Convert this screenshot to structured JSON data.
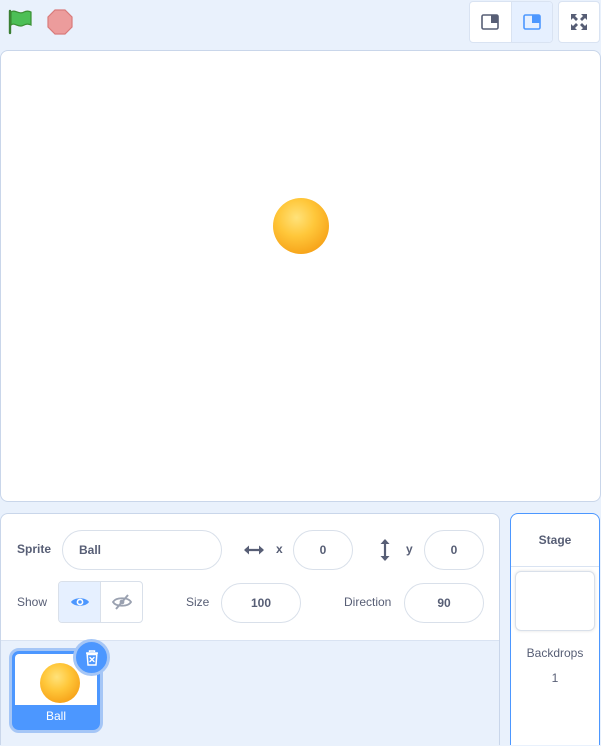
{
  "toolbar": {
    "green_flag_icon": "green-flag-icon",
    "stop_icon": "stop-icon",
    "layout_small_icon": "small-stage-icon",
    "layout_normal_icon": "normal-stage-icon",
    "fullscreen_icon": "fullscreen-icon"
  },
  "stage": {
    "sprite_icon": "ball-sprite"
  },
  "sprite_info": {
    "sprite_label": "Sprite",
    "sprite_name": "Ball",
    "x_label": "x",
    "x_value": "0",
    "y_label": "y",
    "y_value": "0",
    "show_label": "Show",
    "size_label": "Size",
    "size_value": "100",
    "direction_label": "Direction",
    "direction_value": "90"
  },
  "sprite_list": {
    "items": [
      {
        "name": "Ball",
        "selected": true
      }
    ]
  },
  "stage_selector": {
    "title": "Stage",
    "backdrops_label": "Backdrops",
    "backdrops_count": "1"
  },
  "colors": {
    "accent": "#4c97ff",
    "background": "#e9f1fc",
    "text": "#575e75",
    "flag": "#45993d",
    "stop": "#ec9c9c",
    "ball": "#ffc73a"
  }
}
